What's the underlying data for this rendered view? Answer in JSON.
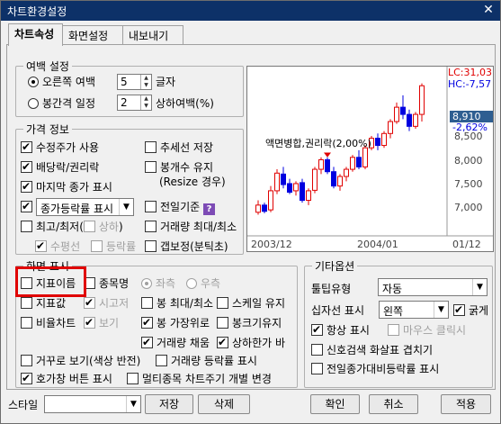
{
  "window": {
    "title": "차트환경설정",
    "close_glyph": "✕"
  },
  "tabs": [
    {
      "label": "차트속성",
      "active": true
    },
    {
      "label": "화면설정",
      "active": false
    },
    {
      "label": "내보내기",
      "active": false
    }
  ],
  "margin": {
    "label": "여백 설정",
    "right_margin": {
      "label": "오른쪽 여백",
      "value": "5",
      "unit": "글자",
      "selected": true
    },
    "spacing": {
      "label": "봉간격 일정",
      "value": "2",
      "unit": "상하여백(%)",
      "selected": false
    }
  },
  "price_info": {
    "label": "가격 정보",
    "items": [
      {
        "label": "수정주가 사용",
        "checked": true
      },
      {
        "label": "추세선 저장",
        "checked": false
      },
      {
        "label": "배당락/권리락",
        "checked": true
      },
      {
        "label": "봉개수 유지",
        "checked": false
      },
      {
        "label": "(Resize 경우)"
      },
      {
        "label": "마지막 종가 표시",
        "checked": true
      },
      {
        "label": "종가등락률 표시",
        "checked": true
      },
      {
        "label": "전일기준",
        "checked": false
      },
      {
        "label": "최고/최저(",
        "checked": false
      },
      {
        "label": "상하",
        "checked": false
      },
      {
        "label": ")"
      },
      {
        "label": "거래량 최대/최소",
        "checked": false
      },
      {
        "label": "수평선",
        "checked": true
      },
      {
        "label": "등락률",
        "checked": false
      },
      {
        "label": "갭보정(분틱초)",
        "checked": false
      }
    ],
    "help_glyph": "?"
  },
  "preview": {
    "lc": "LC:31,03",
    "hc": "HC:-7,57",
    "price_last": "8,910",
    "price_pct": "-2,62%",
    "prices": [
      "8,500",
      "8,000",
      "7,500",
      "7,000"
    ],
    "dates": [
      "2003/12",
      "2004/01",
      "01/12"
    ],
    "annotation": "액면병합,권리락(2,00%)",
    "candles": [
      [
        7000,
        7250,
        6950,
        7150
      ],
      [
        7150,
        7200,
        6980,
        7020
      ],
      [
        7050,
        7550,
        7000,
        7450
      ],
      [
        7450,
        7900,
        7380,
        7820
      ],
      [
        7800,
        7950,
        7500,
        7580
      ],
      [
        7600,
        7700,
        7380,
        7420
      ],
      [
        7450,
        7650,
        7350,
        7600
      ],
      [
        7620,
        7700,
        7200,
        7250
      ],
      [
        7250,
        7500,
        7150,
        7450
      ],
      [
        7460,
        7950,
        7400,
        7900
      ],
      [
        7900,
        8150,
        7800,
        8100
      ],
      [
        8100,
        8150,
        7800,
        7850
      ],
      [
        7850,
        7950,
        7500,
        7550
      ],
      [
        7550,
        7800,
        7450,
        7750
      ],
      [
        7750,
        7950,
        7650,
        7900
      ],
      [
        7900,
        8200,
        7850,
        8150
      ],
      [
        8150,
        8300,
        7900,
        7950
      ],
      [
        7950,
        8400,
        7900,
        8350
      ],
      [
        8350,
        8600,
        8300,
        8550
      ],
      [
        8550,
        8650,
        8300,
        8400
      ],
      [
        8400,
        8700,
        8350,
        8650
      ],
      [
        8650,
        8950,
        8550,
        8900
      ],
      [
        8900,
        9300,
        8850,
        9200
      ],
      [
        9200,
        9450,
        8950,
        9050
      ],
      [
        9050,
        9150,
        8700,
        8800
      ],
      [
        8800,
        9100,
        8750,
        9050
      ],
      [
        9050,
        9700,
        8900,
        9650
      ]
    ],
    "colors": {
      "up": "#e00000",
      "down": "#0000e0"
    }
  },
  "display": {
    "label": "화면 표시",
    "items": [
      {
        "label": "지표이름",
        "checked": false
      },
      {
        "label": "종목명",
        "checked": false
      },
      {
        "label": "좌측",
        "checked": true
      },
      {
        "label": "우측",
        "checked": false
      },
      {
        "label": "지표값",
        "checked": false
      },
      {
        "label": "시고저",
        "checked": true
      },
      {
        "label": "봉 최대/최소",
        "checked": false
      },
      {
        "label": "스케일 유지",
        "checked": false
      },
      {
        "label": "비율차트",
        "checked": false
      },
      {
        "label": "보기",
        "checked": true
      },
      {
        "label": "봉 가장위로",
        "checked": true
      },
      {
        "label": "봉크기유지",
        "checked": false
      },
      {
        "label": "거래량 채움",
        "checked": true
      },
      {
        "label": "상하한가 바",
        "checked": true
      },
      {
        "label": "거꾸로 보기(색상 반전)",
        "checked": false
      },
      {
        "label": "거래량 등락률 표시",
        "checked": false
      },
      {
        "label": "호가창 버튼 표시",
        "checked": true
      },
      {
        "label": "멀티종목 차트주기 개별 변경",
        "checked": false
      }
    ]
  },
  "other": {
    "label": "기타옵션",
    "toolbar_type": {
      "label": "툴팁유형",
      "value": "자동"
    },
    "crosshair": {
      "label": "십자선 표시",
      "value": "왼쪽"
    },
    "bold": {
      "label": "굵게",
      "checked": true
    },
    "items": [
      {
        "label": "항상 표시",
        "checked": true
      },
      {
        "label": "마우스 클릭시",
        "checked": false
      },
      {
        "label": "신호검색 화살표 겹치기",
        "checked": false
      },
      {
        "label": "전일종가대비등락률 표시",
        "checked": false
      }
    ]
  },
  "footer": {
    "style_label": "스타일",
    "style_value": "",
    "save": "저장",
    "delete": "삭제",
    "ok": "확인",
    "cancel": "취소",
    "apply": "적용"
  }
}
